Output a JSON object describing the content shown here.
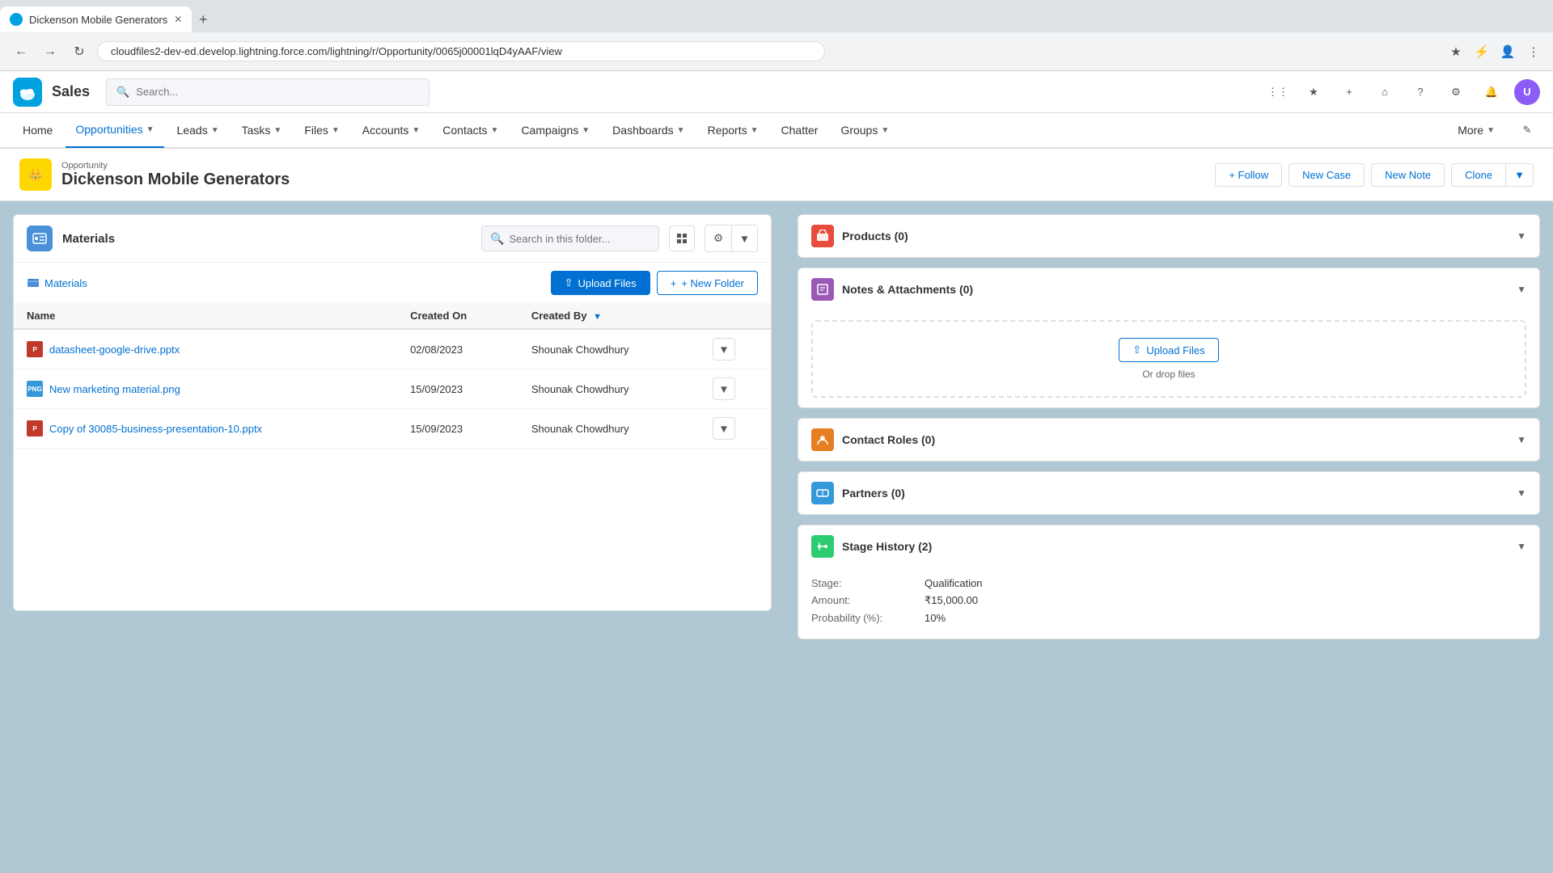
{
  "browser": {
    "tab_title": "Dickenson Mobile Generators",
    "url": "cloudfiles2-dev-ed.develop.lightning.force.com/lightning/r/Opportunity/0065j00001lqD4yAAF/view",
    "new_tab_label": "+"
  },
  "topnav": {
    "app_name": "Sales",
    "search_placeholder": "Search...",
    "icons": [
      "apps-icon",
      "star-icon",
      "plus-icon",
      "home-icon",
      "help-icon",
      "settings-icon",
      "bell-icon"
    ]
  },
  "mainnav": {
    "items": [
      {
        "label": "Home",
        "active": false,
        "has_dropdown": false
      },
      {
        "label": "Opportunities",
        "active": true,
        "has_dropdown": true
      },
      {
        "label": "Leads",
        "active": false,
        "has_dropdown": true
      },
      {
        "label": "Tasks",
        "active": false,
        "has_dropdown": true
      },
      {
        "label": "Files",
        "active": false,
        "has_dropdown": true
      },
      {
        "label": "Accounts",
        "active": false,
        "has_dropdown": true
      },
      {
        "label": "Contacts",
        "active": false,
        "has_dropdown": true
      },
      {
        "label": "Campaigns",
        "active": false,
        "has_dropdown": true
      },
      {
        "label": "Dashboards",
        "active": false,
        "has_dropdown": true
      },
      {
        "label": "Reports",
        "active": false,
        "has_dropdown": true
      },
      {
        "label": "Chatter",
        "active": false,
        "has_dropdown": false
      },
      {
        "label": "Groups",
        "active": false,
        "has_dropdown": true
      },
      {
        "label": "More",
        "active": false,
        "has_dropdown": true
      }
    ]
  },
  "record_header": {
    "object_type": "Opportunity",
    "record_name": "Dickenson Mobile Generators",
    "follow_label": "+ Follow",
    "new_case_label": "New Case",
    "new_note_label": "New Note",
    "clone_label": "Clone"
  },
  "materials_widget": {
    "title": "Materials",
    "search_placeholder": "Search in this folder...",
    "breadcrumb": "Materials",
    "upload_files_label": "Upload Files",
    "new_folder_label": "+ New Folder",
    "columns": [
      {
        "key": "name",
        "label": "Name"
      },
      {
        "key": "created_on",
        "label": "Created On"
      },
      {
        "key": "created_by",
        "label": "Created By"
      }
    ],
    "files": [
      {
        "name": "datasheet-google-drive.pptx",
        "type": "pptx",
        "created_on": "02/08/2023",
        "created_by": "Shounak Chowdhury"
      },
      {
        "name": "New marketing material.png",
        "type": "png",
        "created_on": "15/09/2023",
        "created_by": "Shounak Chowdhury"
      },
      {
        "name": "Copy of 30085-business-presentation-10.pptx",
        "type": "pptx",
        "created_on": "15/09/2023",
        "created_by": "Shounak Chowdhury"
      }
    ]
  },
  "right_panel": {
    "products": {
      "title": "Products (0)",
      "icon_color": "#e74c3c"
    },
    "notes": {
      "title": "Notes & Attachments (0)",
      "upload_label": "Upload Files",
      "drop_label": "Or drop files",
      "icon_color": "#8e44ad"
    },
    "contact_roles": {
      "title": "Contact Roles (0)",
      "icon_color": "#e67e22"
    },
    "partners": {
      "title": "Partners (0)",
      "icon_color": "#2980b9"
    },
    "stage_history": {
      "title": "Stage History (2)",
      "icon_color": "#27ae60",
      "stage_label": "Stage:",
      "stage_value": "Qualification",
      "amount_label": "Amount:",
      "amount_value": "₹15,000.00",
      "probability_label": "Probability (%):",
      "probability_value": "10%"
    }
  }
}
